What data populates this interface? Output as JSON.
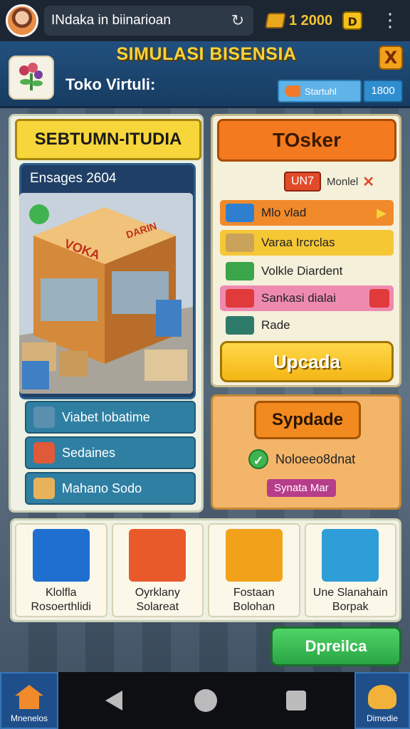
{
  "topbar": {
    "search_text": "INdaka in biinarioan",
    "coins": "1 2000",
    "gold_badge": "D"
  },
  "header": {
    "title": "SIMULASI BISENSIA",
    "subtitle": "Toko Virtuli:",
    "status_label": "Startuhl",
    "status_value": "1800",
    "close_label": "X"
  },
  "left": {
    "banner": "SEBTUMN-ITUDIA",
    "store_title": "Ensages 2604",
    "store_sign_left": "VOKA",
    "store_sign_right": "DARIN",
    "items": [
      {
        "label": "Viabet lobatime",
        "icon": "box-icon",
        "color": "#5b8fb0"
      },
      {
        "label": "Sedaines",
        "icon": "package-icon",
        "color": "#e05a3a"
      },
      {
        "label": "Mahano Sodo",
        "icon": "crate-icon",
        "color": "#e7b25a"
      }
    ]
  },
  "right": {
    "header_button": "TOsker",
    "badge": "UN7",
    "badge_text": "Monlel",
    "rows": [
      {
        "label": "Mlo vlad",
        "bg": "#f08a2b",
        "icon_color": "#2f7fd0"
      },
      {
        "label": "Varaa Ircrclas",
        "bg": "#f6c735",
        "icon_color": "#c9a35a"
      },
      {
        "label": "Volkle Diardent",
        "bg": "transparent",
        "icon_color": "#3aa54a"
      },
      {
        "label": "Sankasi dialai",
        "bg": "#ee8ab0",
        "icon_color": "#e03a3a"
      },
      {
        "label": "Rade",
        "bg": "transparent",
        "icon_color": "#2e7b6a"
      }
    ],
    "upgrade_button": "Upcada"
  },
  "right2": {
    "button": "Sypdade",
    "check_text": "Noloeeo8dnat",
    "tag": "Synata Mar"
  },
  "cards": [
    {
      "line1": "Klolfla",
      "line2": "Rosoerthlidi",
      "icon": "shopping-cart-icon",
      "color": "#1f6fd0"
    },
    {
      "line1": "Oyrklany",
      "line2": "Solareat",
      "icon": "grocery-cart-icon",
      "color": "#e95a2a"
    },
    {
      "line1": "Fostaan",
      "line2": "Bolohan",
      "icon": "puzzle-icon",
      "color": "#f2a21a"
    },
    {
      "line1": "Une Slanahain",
      "line2": "Borpak",
      "icon": "shop-stall-icon",
      "color": "#2f9ed8"
    }
  ],
  "green_button": "Dpreilca",
  "nav": {
    "left_label": "Mnenelos",
    "right_label": "Dimedie"
  }
}
